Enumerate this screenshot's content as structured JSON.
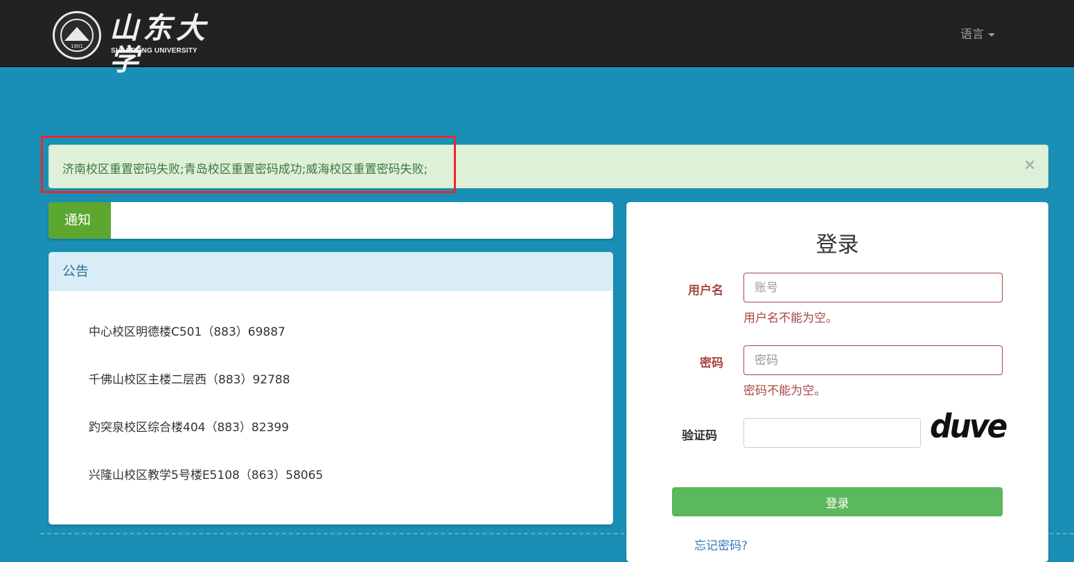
{
  "header": {
    "logo_cn": "山东大学",
    "logo_en": "SHANDONG UNIVERSITY",
    "logo_year": "1901",
    "language_label": "语言"
  },
  "alert": {
    "message": "济南校区重置密码失败;青岛校区重置密码成功;威海校区重置密码失败;",
    "close_symbol": "×"
  },
  "notice": {
    "tag_label": "通知"
  },
  "announcement": {
    "title": "公告",
    "items": [
      "中心校区明德楼C501（883）69887",
      "千佛山校区主楼二层西（883）92788",
      "趵突泉校区综合楼404（883）82399",
      "兴隆山校区教学5号楼E5108（863）58065"
    ]
  },
  "login": {
    "title": "登录",
    "username_label": "用户名",
    "username_placeholder": "账号",
    "username_value": "",
    "username_error": "用户名不能为空。",
    "password_label": "密码",
    "password_placeholder": "密码",
    "password_value": "",
    "password_error": "密码不能为空。",
    "captcha_label": "验证码",
    "captcha_value": "",
    "captcha_image_text": "duve",
    "submit_label": "登录",
    "forgot_label": "忘记密码?"
  },
  "colors": {
    "background": "#1a8fb5",
    "navbar": "#222222",
    "alert_bg": "#dff0d8",
    "alert_text": "#3c763d",
    "notice_tag": "#5ca730",
    "error": "#a94442",
    "button": "#5cb85c",
    "link": "#337ab7",
    "highlight_box": "#e8282a"
  }
}
